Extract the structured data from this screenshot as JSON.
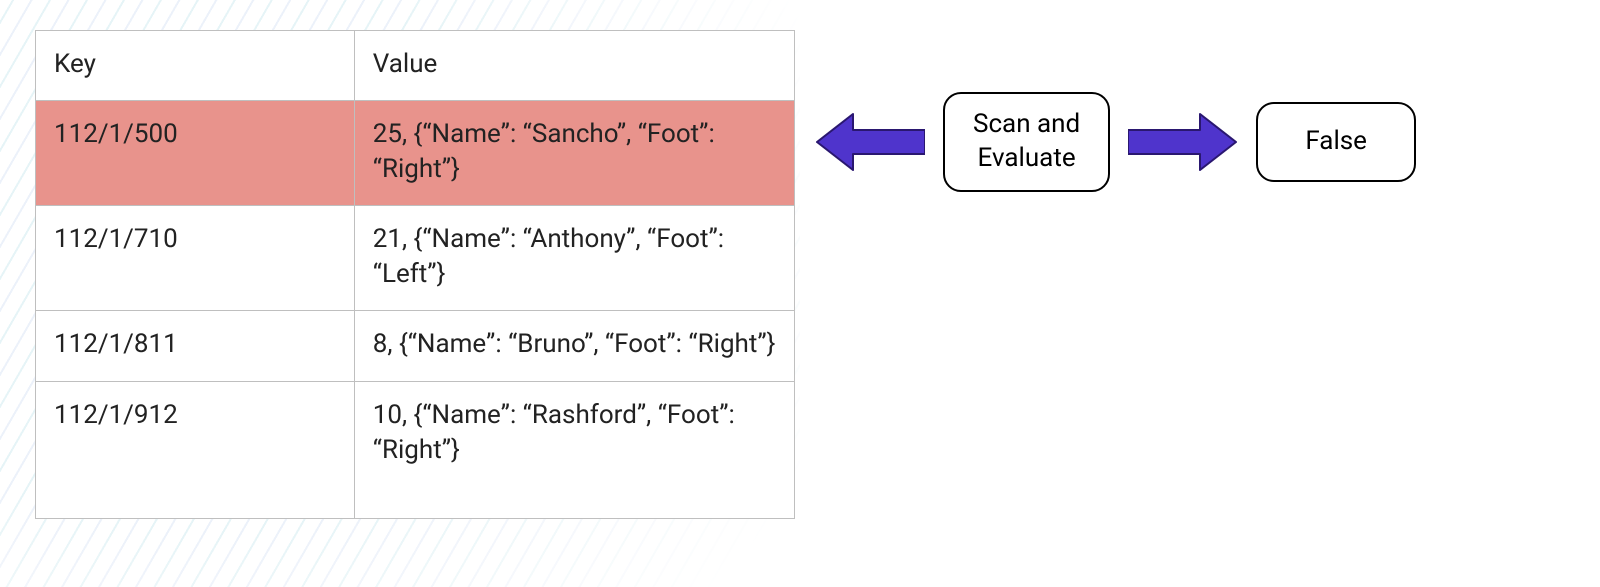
{
  "colors": {
    "highlight": "#e8938c",
    "arrow": "#4f34cc",
    "border": "#bfbfbf"
  },
  "table": {
    "headers": {
      "key": "Key",
      "value": "Value"
    },
    "rows": [
      {
        "key": "112/1/500",
        "value": "25, {“Name”: “Sancho”, “Foot”: “Right”}",
        "highlighted": true
      },
      {
        "key": "112/1/710",
        "value": "21, {“Name”: “Anthony”, “Foot”: “Left”}",
        "highlighted": false
      },
      {
        "key": "112/1/811",
        "value": "8, {“Name”: “Bruno”, “Foot”: “Right”}",
        "highlighted": false
      },
      {
        "key": "112/1/912",
        "value": "10, {“Name”: “Rashford”, “Foot”: “Right”}",
        "highlighted": false
      }
    ]
  },
  "scan_box": {
    "label": "Scan and Evaluate"
  },
  "result_box": {
    "label": "False"
  }
}
